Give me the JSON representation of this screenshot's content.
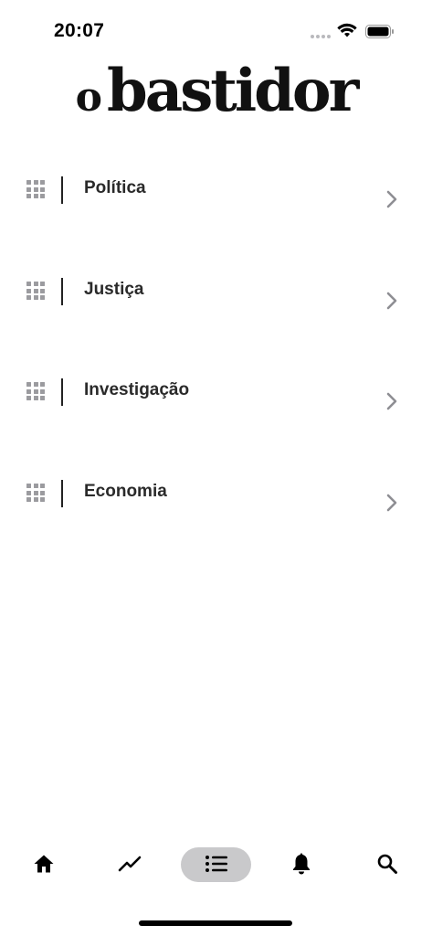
{
  "status_bar": {
    "time": "20:07"
  },
  "logo": {
    "article": "o",
    "name": "bastidor"
  },
  "categories": [
    {
      "label": "Política"
    },
    {
      "label": "Justiça"
    },
    {
      "label": "Investigação"
    },
    {
      "label": "Economia"
    }
  ],
  "tab_bar": {
    "tabs": [
      {
        "icon": "home-icon",
        "selected": false
      },
      {
        "icon": "trending-icon",
        "selected": false
      },
      {
        "icon": "list-icon",
        "selected": true
      },
      {
        "icon": "bell-icon",
        "selected": false
      },
      {
        "icon": "search-icon",
        "selected": false
      }
    ],
    "selected_color": "#c9c9cb"
  }
}
